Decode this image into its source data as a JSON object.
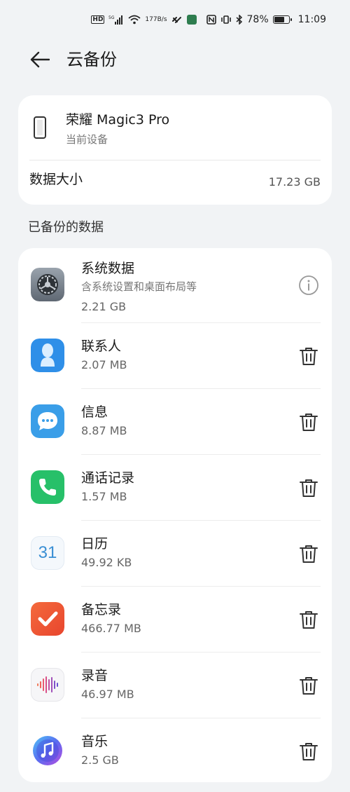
{
  "status_bar": {
    "hd": "HD",
    "network": "5G",
    "speed_value": "177",
    "speed_unit": "B/s",
    "battery": "78%",
    "battery_level": 0.78,
    "time": "11:09"
  },
  "header": {
    "title": "云备份"
  },
  "device": {
    "name": "荣耀 Magic3 Pro",
    "subtitle": "当前设备",
    "size_label": "数据大小",
    "size_value": "17.23 GB"
  },
  "backup_section": {
    "title": "已备份的数据",
    "items": [
      {
        "name": "系统数据",
        "subtitle": "含系统设置和桌面布局等",
        "size": "2.21 GB",
        "action": "info-icon"
      },
      {
        "name": "联系人",
        "size": "2.07 MB",
        "action": "trash-icon"
      },
      {
        "name": "信息",
        "size": "8.87 MB",
        "action": "trash-icon"
      },
      {
        "name": "通话记录",
        "size": "1.57 MB",
        "action": "trash-icon"
      },
      {
        "name": "日历",
        "size": "49.92 KB",
        "action": "trash-icon",
        "icon_text": "31"
      },
      {
        "name": "备忘录",
        "size": "466.77 MB",
        "action": "trash-icon"
      },
      {
        "name": "录音",
        "size": "46.97 MB",
        "action": "trash-icon"
      },
      {
        "name": "音乐",
        "size": "2.5 GB",
        "action": "trash-icon"
      }
    ]
  },
  "colors": {
    "background": "#f1f3f5",
    "card": "#ffffff",
    "contacts_blue": "#2f8fe8",
    "messages_blue": "#3a9ee8",
    "phone_green": "#27c069",
    "notes_orange": "#f05a3a",
    "calendar_blue": "#3a8fd4"
  }
}
